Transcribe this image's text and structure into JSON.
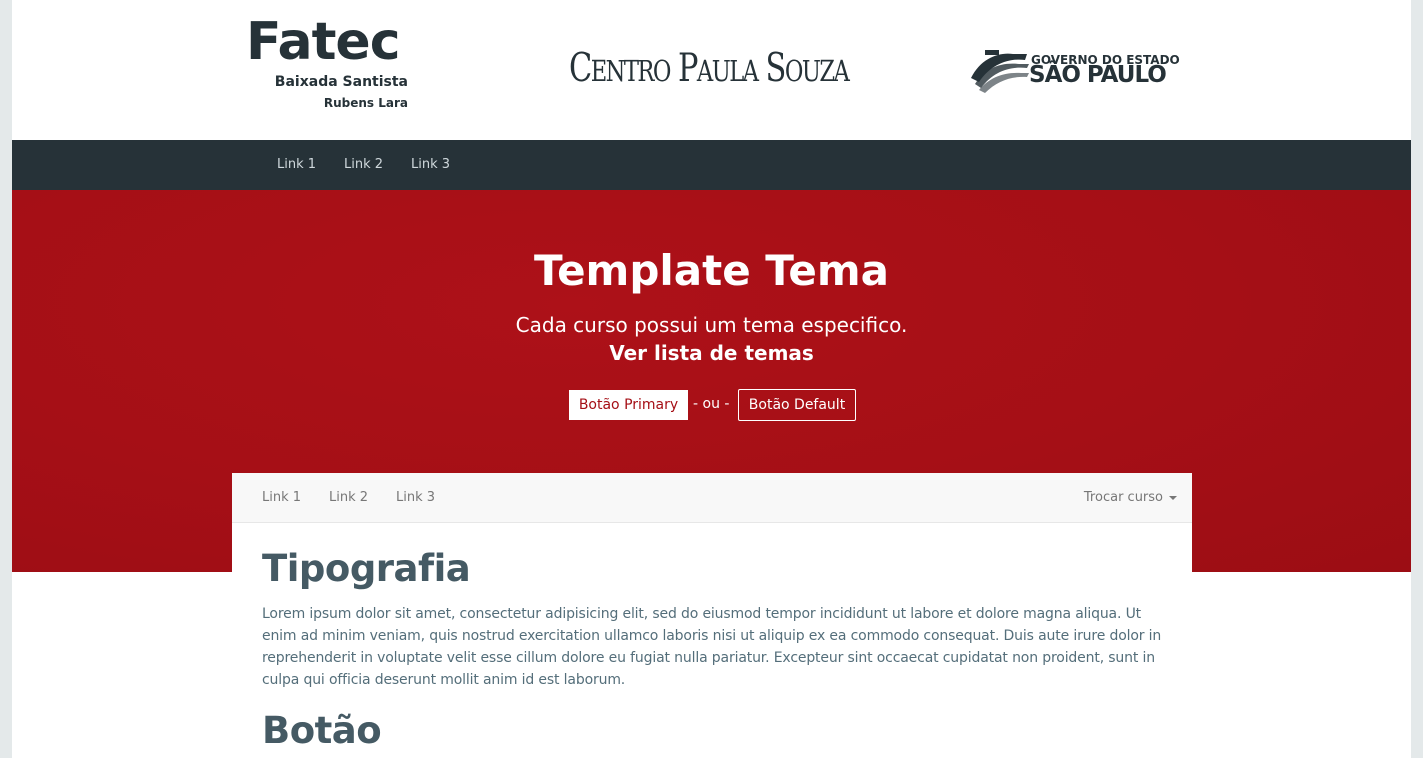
{
  "header": {
    "fatec": {
      "name": "Fatec",
      "line1": "Baixada Santista",
      "line2": "Rubens Lara"
    },
    "cps": {
      "first_c": "C",
      "entro": "ENTRO",
      "first_p": "P",
      "aula": "AULA",
      "first_s": "S",
      "ouza": "OUZA"
    },
    "gov": {
      "line1": "GOVERNO DO ESTADO",
      "line2": "SÃO PAULO"
    }
  },
  "topnav": {
    "items": [
      "Link 1",
      "Link 2",
      "Link 3"
    ]
  },
  "hero": {
    "title": "Template Tema",
    "lead": "Cada curso possui um tema especifico.",
    "link": "Ver lista de temas",
    "btn_primary": "Botão Primary",
    "or": "- ou -",
    "btn_default": "Botão Default"
  },
  "subnav": {
    "items": [
      "Link 1",
      "Link 2",
      "Link 3"
    ],
    "dropdown": "Trocar curso"
  },
  "content": {
    "h_tipografia": "Tipografia",
    "paragraph": "Lorem ipsum dolor sit amet, consectetur adipisicing elit, sed do eiusmod tempor incididunt ut labore et dolore magna aliqua. Ut enim ad minim veniam, quis nostrud exercitation ullamco laboris nisi ut aliquip ex ea commodo consequat. Duis aute irure dolor in reprehenderit in voluptate velit esse cillum dolore eu fugiat nulla pariatur. Excepteur sint occaecat cupidatat non proident, sunt in culpa qui officia deserunt mollit anim id est laborum.",
    "h_botao": "Botão"
  },
  "colors": {
    "brand_red": "#a50f16",
    "dark_nav": "#263238",
    "heading": "#455a64",
    "text": "#546e7a"
  }
}
